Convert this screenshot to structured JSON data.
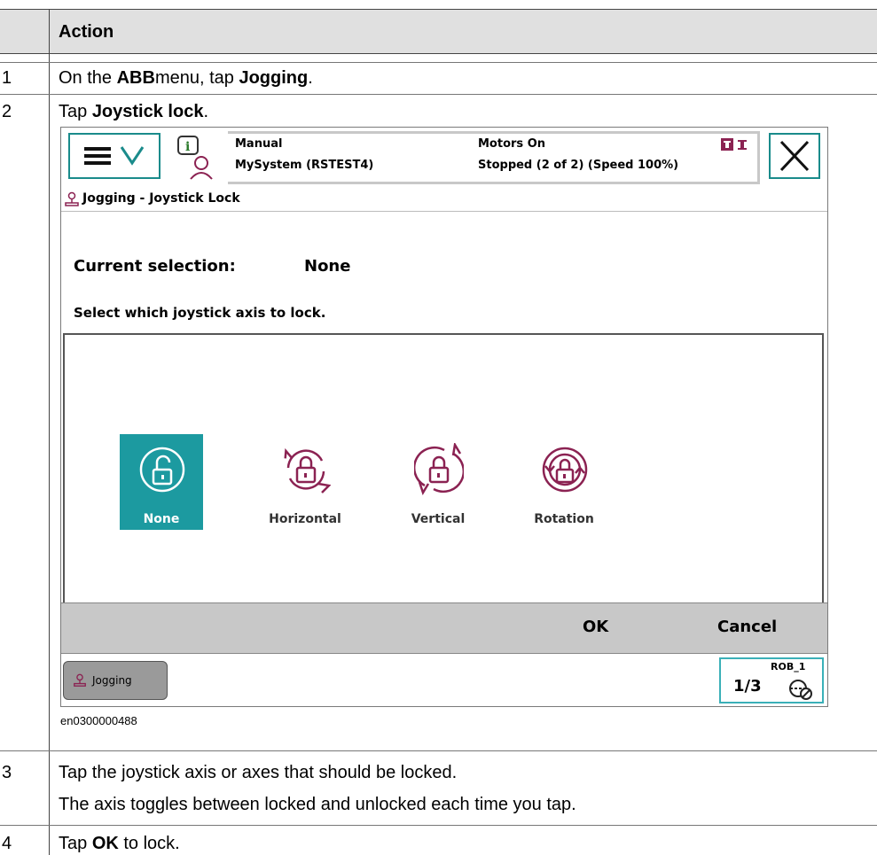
{
  "table": {
    "header": "Action",
    "rows": [
      {
        "num": "1",
        "prefix": "On the ",
        "bold1": "ABB",
        "mid": "menu, tap ",
        "bold2": "Jogging",
        "suffix": "."
      },
      {
        "num": "2",
        "prefix": "Tap ",
        "bold1": "Joystick lock",
        "suffix": "."
      },
      {
        "num": "3",
        "line1": "Tap the joystick axis or axes that should be locked.",
        "line2": "The axis toggles between locked and unlocked each time you tap."
      },
      {
        "num": "4",
        "prefix": "Tap ",
        "bold1": "OK",
        "suffix": " to lock."
      }
    ]
  },
  "screen": {
    "status": {
      "mode": "Manual",
      "system": "MySystem (RSTEST4)",
      "motors": "Motors On",
      "state": "Stopped (2 of 2) (Speed 100%)"
    },
    "title": "Jogging - Joystick Lock",
    "current_label": "Current selection:",
    "current_value": "None",
    "instruction": "Select which joystick axis to lock.",
    "options": [
      {
        "label": "None",
        "icon": "unlock-icon",
        "selected": true
      },
      {
        "label": "Horizontal",
        "icon": "horizontal-lock-icon",
        "selected": false
      },
      {
        "label": "Vertical",
        "icon": "vertical-lock-icon",
        "selected": false
      },
      {
        "label": "Rotation",
        "icon": "rotation-lock-icon",
        "selected": false
      }
    ],
    "ok_label": "OK",
    "cancel_label": "Cancel",
    "taskbar_label": "Jogging",
    "rob_label": "ROB_1",
    "rob_fraction": "1/3",
    "accent_color": "#1c9aa0",
    "icon_color": "#8b2252"
  },
  "caption": "en0300000488"
}
